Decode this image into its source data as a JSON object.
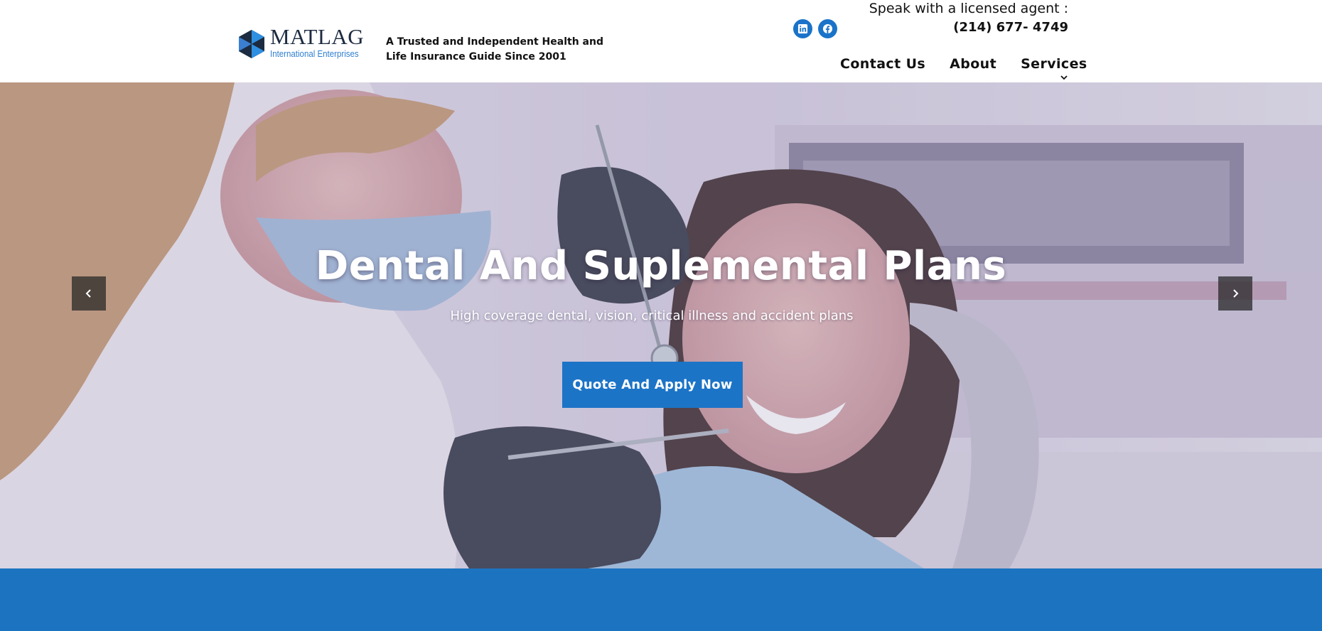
{
  "header": {
    "logo": {
      "name": "MATLAG",
      "subtitle": "International Enterprises"
    },
    "tagline": "A Trusted and Independent Health and Life Insurance Guide Since 2001",
    "social": [
      {
        "icon": "linkedin-icon"
      },
      {
        "icon": "facebook-icon"
      }
    ],
    "agent_label": "Speak with a licensed agent :",
    "agent_phone": "(214) 677- 4749",
    "nav": {
      "contact_label": "Contact Us",
      "about_label": "About",
      "services_label": "Services"
    }
  },
  "hero": {
    "title": "Dental And Suplemental Plans",
    "subtitle": "High coverage dental, vision, critical illness and accident plans",
    "cta_label": "Quote And Apply Now",
    "prev_icon": "chevron-left-icon",
    "next_icon": "chevron-right-icon"
  },
  "colors": {
    "brand_blue": "#1c74c7",
    "band_blue": "#1c74c0",
    "social_blue": "#1a73c9"
  }
}
